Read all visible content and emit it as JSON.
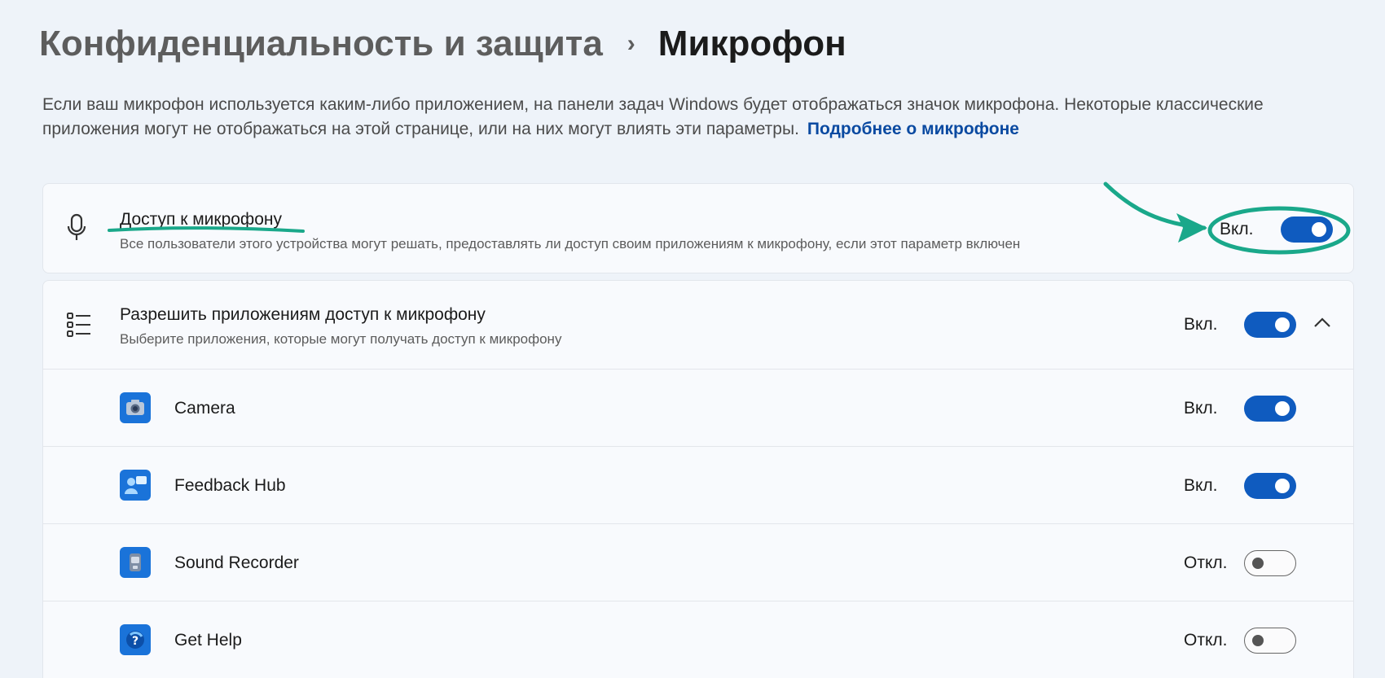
{
  "breadcrumb": {
    "parent": "Конфиденциальность и защита",
    "separator": "›",
    "current": "Микрофон"
  },
  "description": {
    "text": "Если ваш микрофон используется каким-либо приложением, на панели задач Windows будет отображаться значок микрофона. Некоторые классические приложения могут не отображаться на этой странице, или на них могут влиять эти параметры.",
    "link": "Подробнее о микрофоне"
  },
  "microphone_access": {
    "icon": "microphone-icon",
    "title": "Доступ к микрофону",
    "subtitle": "Все пользователи этого устройства могут решать, предоставлять ли доступ своим приложениям к микрофону, если этот параметр включен",
    "state_label": "Вкл.",
    "enabled": true
  },
  "app_access": {
    "icon": "list-icon",
    "title": "Разрешить приложениям доступ к микрофону",
    "subtitle": "Выберите приложения, которые могут получать доступ к микрофону",
    "state_label": "Вкл.",
    "enabled": true,
    "expand_icon": "chevron-up-icon"
  },
  "apps": [
    {
      "name": "Camera",
      "icon": "camera-icon",
      "state_label": "Вкл.",
      "enabled": true
    },
    {
      "name": "Feedback Hub",
      "icon": "feedback-hub-icon",
      "state_label": "Вкл.",
      "enabled": true
    },
    {
      "name": "Sound Recorder",
      "icon": "sound-recorder-icon",
      "state_label": "Откл.",
      "enabled": false
    },
    {
      "name": "Get Help",
      "icon": "get-help-icon",
      "state_label": "Откл.",
      "enabled": false
    }
  ],
  "colors": {
    "accent": "#0f5bbf",
    "link": "#0a4aa1",
    "annotation": "#1aa88a",
    "app_icon": "#1a73d9"
  }
}
